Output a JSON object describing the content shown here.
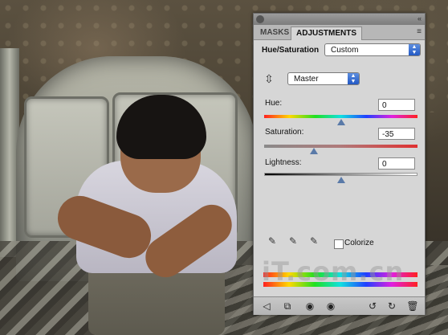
{
  "panel": {
    "tabs": [
      {
        "label": "MASKS"
      },
      {
        "label": "ADJUSTMENTS"
      }
    ],
    "title": "Hue/Saturation",
    "preset_value": "Custom",
    "channel_value": "Master",
    "hue": {
      "label": "Hue:",
      "value": "0"
    },
    "saturation": {
      "label": "Saturation:",
      "value": "-35"
    },
    "lightness": {
      "label": "Lightness:",
      "value": "0"
    },
    "colorize_label": "Colorize",
    "watermark": "iT.com.cn"
  },
  "icons": {
    "collapse": "«",
    "menu": "≡",
    "close": "×",
    "hand_tool": "⇳",
    "back": "◁",
    "clip": "⧉",
    "visibility": "◉",
    "eye": "◉",
    "reset_prev": "↺",
    "reset": "↻",
    "trash": "🗑"
  }
}
